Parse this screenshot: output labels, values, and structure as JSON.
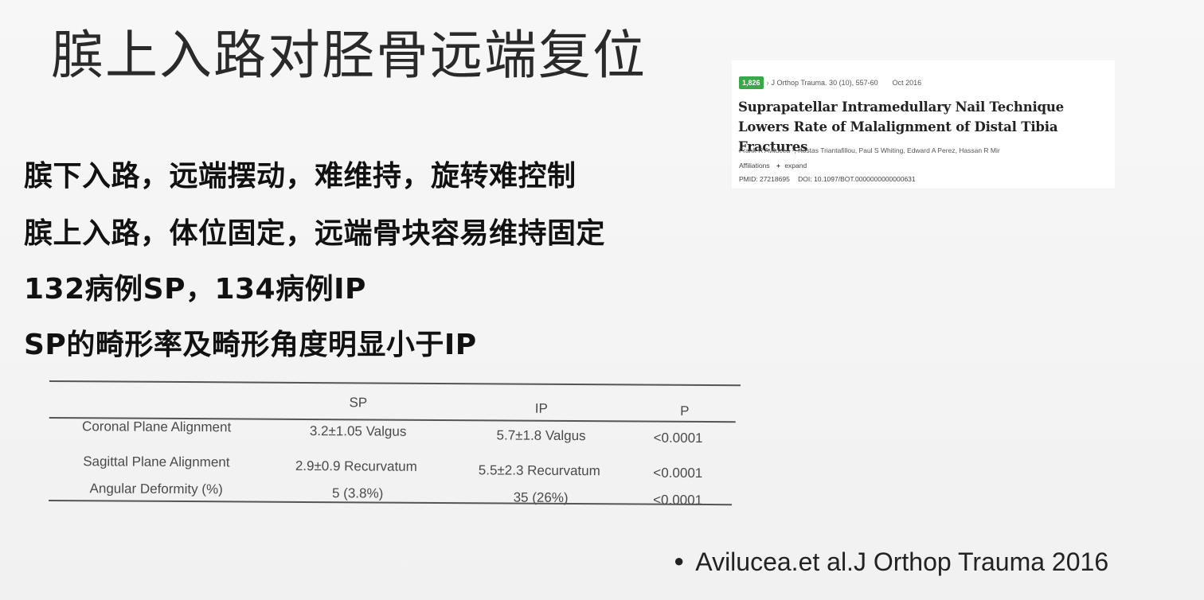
{
  "slide": {
    "title": "膑上入路对胫骨远端复位",
    "bullets": [
      "膑下入路，远端摆动，难维持，旋转难控制",
      "膑上入路，体位固定，远端骨块容易维持固定",
      "132病例SP，134病例IP",
      "SP的畸形率及畸形角度明显小于IP"
    ],
    "citation": "Avilucea.et al.J Orthop Trauma 2016"
  },
  "article": {
    "badge": "1,826",
    "chevron_icon": "chevron-right-icon",
    "journal": "J Orthop Trauma. 30 (10), 557-60",
    "date": "Oct 2016",
    "title": "Suprapatellar Intramedullary Nail Technique Lowers Rate of Malalignment of Distal Tibia Fractures",
    "authors": "Frank R Avilucea ¹, Kostas Triantafillou, Paul S Whiting, Edward A Perez, Hassan R Mir",
    "affiliations_label": "Affiliations",
    "expand_label": "expand",
    "pmid": "PMID: 27218695",
    "doi": "DOI: 10.1097/BOT.0000000000000631",
    "badge_color": "#3aa84a"
  },
  "table": {
    "headers": [
      "",
      "SP",
      "IP",
      "P"
    ],
    "rows": [
      [
        "Coronal Plane Alignment",
        "3.2±1.05 Valgus",
        "5.7±1.8 Valgus",
        "<0.0001"
      ],
      [
        "Sagittal Plane Alignment",
        "2.9±0.9 Recurvatum",
        "5.5±2.3 Recurvatum",
        "<0.0001"
      ],
      [
        "Angular Deformity (%)",
        "5 (3.8%)",
        "35 (26%)",
        "<0.0001"
      ]
    ]
  }
}
